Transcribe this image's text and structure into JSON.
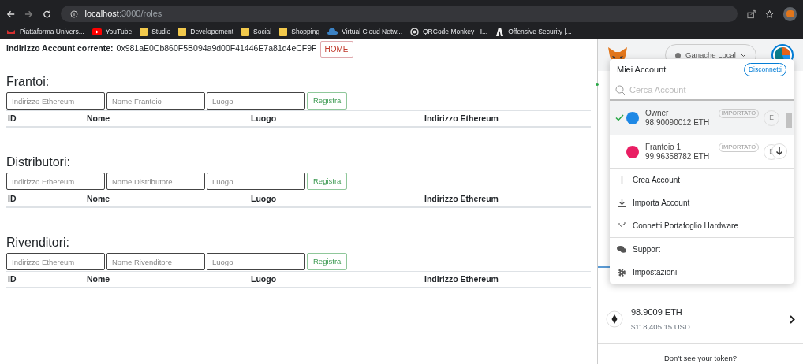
{
  "browser": {
    "url_host": "localhost",
    "url_path": ":3000/roles",
    "bookmarks": [
      {
        "label": "Piattaforma Univers...",
        "kind": "red-logo"
      },
      {
        "label": "YouTube",
        "kind": "youtube"
      },
      {
        "label": "Studio",
        "kind": "folder"
      },
      {
        "label": "Developement",
        "kind": "folder"
      },
      {
        "label": "Social",
        "kind": "folder"
      },
      {
        "label": "Shopping",
        "kind": "folder"
      },
      {
        "label": "Virtual Cloud Netw...",
        "kind": "cloud"
      },
      {
        "label": "QRCode Monkey - I...",
        "kind": "qr"
      },
      {
        "label": "Offensive Security |...",
        "kind": "dark-logo"
      }
    ]
  },
  "page": {
    "account_label": "Indirizzo Account corrente:",
    "account_address": "0x981aE0Cb860F5B094a9d00F41446E7a81d4eCF9F",
    "home_button": "HOME",
    "sections": [
      {
        "title": "Frantoi:",
        "inputs": [
          {
            "placeholder": "Indirizzo Ethereum"
          },
          {
            "placeholder": "Nome Frantoio"
          },
          {
            "placeholder": "Luogo"
          }
        ],
        "button": "Registra",
        "columns": [
          "ID",
          "Nome",
          "Luogo",
          "Indirizzo Ethereum"
        ]
      },
      {
        "title": "Distributori:",
        "inputs": [
          {
            "placeholder": "Indirizzo Ethereum"
          },
          {
            "placeholder": "Nome Distributore"
          },
          {
            "placeholder": "Luogo"
          }
        ],
        "button": "Registra",
        "columns": [
          "ID",
          "Nome",
          "Luogo",
          "Indirizzo Ethereum"
        ]
      },
      {
        "title": "Rivenditori:",
        "inputs": [
          {
            "placeholder": "Indirizzo Ethereum"
          },
          {
            "placeholder": "Nome Rivenditore"
          },
          {
            "placeholder": "Luogo"
          }
        ],
        "button": "Registra",
        "columns": [
          "ID",
          "Nome",
          "Luogo",
          "Indirizzo Ethereum"
        ]
      }
    ]
  },
  "wallet": {
    "network": "Ganache Local",
    "menu": {
      "title": "Miei Account",
      "disconnect": "Disconnetti",
      "search_placeholder": "Cerca Account",
      "accounts": [
        {
          "name": "Owner",
          "balance": "98.90090012 ETH",
          "badge": "IMPORTATO",
          "initial": "E",
          "selected": true,
          "color": "#1e88e5"
        },
        {
          "name": "Frantoio 1",
          "balance": "99.96358782 ETH",
          "badge": "IMPORTATO",
          "initial": "E",
          "selected": false,
          "color": "#e91e63"
        }
      ],
      "actions": [
        {
          "label": "Crea Account",
          "kind": "plus"
        },
        {
          "label": "Importa Account",
          "kind": "download"
        },
        {
          "label": "Connetti Portafoglio Hardware",
          "kind": "usb"
        }
      ],
      "links": [
        {
          "label": "Support",
          "kind": "chat"
        },
        {
          "label": "Impostazioni",
          "kind": "gear"
        }
      ]
    },
    "asset": {
      "amount": "98.9009 ETH",
      "fiat": "$118,405.15 USD"
    },
    "token_link": "Don't see your token?"
  }
}
